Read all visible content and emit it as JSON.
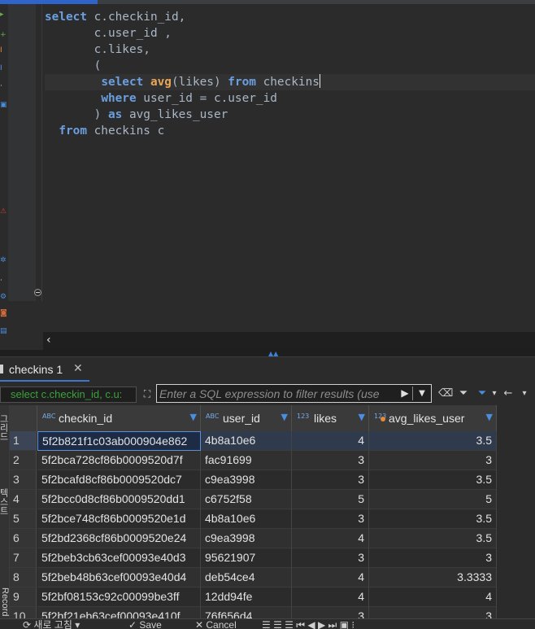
{
  "editor": {
    "lines": [
      [
        {
          "t": "select",
          "k": "kw"
        },
        {
          "t": " c.checkin_id,",
          "k": ""
        }
      ],
      [
        {
          "t": "       c.user_id ,",
          "k": ""
        }
      ],
      [
        {
          "t": "       c.likes,",
          "k": ""
        }
      ],
      [
        {
          "t": "       (",
          "k": ""
        }
      ],
      [
        {
          "t": "        ",
          "k": ""
        },
        {
          "t": "select",
          "k": "kw"
        },
        {
          "t": " ",
          "k": ""
        },
        {
          "t": "avg",
          "k": "fn"
        },
        {
          "t": "(likes) ",
          "k": ""
        },
        {
          "t": "from",
          "k": "kw"
        },
        {
          "t": " checkins",
          "k": ""
        }
      ],
      [
        {
          "t": "        ",
          "k": ""
        },
        {
          "t": "where",
          "k": "kw"
        },
        {
          "t": " user_id = c.user_id",
          "k": ""
        }
      ],
      [
        {
          "t": "       ) ",
          "k": ""
        },
        {
          "t": "as",
          "k": "kw"
        },
        {
          "t": " avg_likes_user",
          "k": ""
        }
      ],
      [
        {
          "t": "  ",
          "k": ""
        },
        {
          "t": "from",
          "k": "kw"
        },
        {
          "t": " checkins c",
          "k": ""
        }
      ]
    ],
    "cursor_line": 4
  },
  "results": {
    "tab_label": "checkins 1",
    "close_glyph": "✕",
    "query_preview": "select c.checkin_id, c.u:",
    "filter_placeholder": "Enter a SQL expression to filter results (use",
    "columns": [
      {
        "name": "checkin_id",
        "type_badge": "ABC"
      },
      {
        "name": "user_id",
        "type_badge": "ABC"
      },
      {
        "name": "likes",
        "type_badge": "123"
      },
      {
        "name": "avg_likes_user",
        "type_badge": "123"
      }
    ],
    "rows": [
      {
        "n": "1",
        "checkin_id": "5f2b821f1c03ab000904e862",
        "user_id": "4b8a10e6",
        "likes": "4",
        "avg": "3.5"
      },
      {
        "n": "2",
        "checkin_id": "5f2bca728cf86b0009520d7f",
        "user_id": "fac91699",
        "likes": "3",
        "avg": "3"
      },
      {
        "n": "3",
        "checkin_id": "5f2bcafd8cf86b0009520dc7",
        "user_id": "c9ea3998",
        "likes": "3",
        "avg": "3.5"
      },
      {
        "n": "4",
        "checkin_id": "5f2bcc0d8cf86b0009520dd1",
        "user_id": "c6752f58",
        "likes": "5",
        "avg": "5"
      },
      {
        "n": "5",
        "checkin_id": "5f2bce748cf86b0009520e1d",
        "user_id": "4b8a10e6",
        "likes": "3",
        "avg": "3.5"
      },
      {
        "n": "6",
        "checkin_id": "5f2bd2368cf86b0009520e24",
        "user_id": "c9ea3998",
        "likes": "4",
        "avg": "3.5"
      },
      {
        "n": "7",
        "checkin_id": "5f2beb3cb63cef00093e40d3",
        "user_id": "95621907",
        "likes": "3",
        "avg": "3"
      },
      {
        "n": "8",
        "checkin_id": "5f2beb48b63cef00093e40d4",
        "user_id": "deb54ce4",
        "likes": "4",
        "avg": "3.3333"
      },
      {
        "n": "9",
        "checkin_id": "5f2bf08153c92c00099be3ff",
        "user_id": "12dd94fe",
        "likes": "4",
        "avg": "4"
      },
      {
        "n": "10",
        "checkin_id": "5f2bf21eb63cef00093e410f",
        "user_id": "76f656d4",
        "likes": "3",
        "avg": "3"
      }
    ]
  },
  "side_panel": {
    "labels": [
      "그리드",
      "텍스트",
      "Record"
    ]
  },
  "bottom": {
    "refresh_label": "새로 고침",
    "save_label": "Save",
    "cancel_label": "Cancel"
  }
}
